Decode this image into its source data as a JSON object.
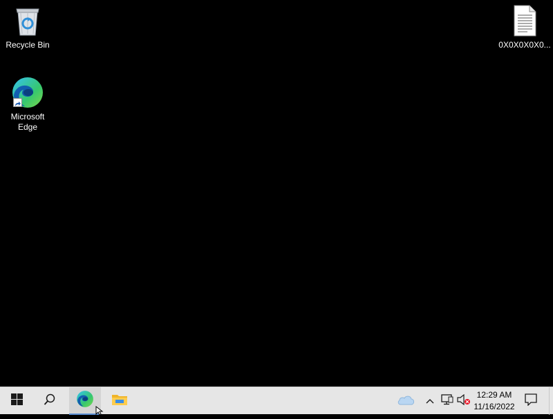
{
  "desktop": {
    "icons": [
      {
        "label": "Recycle Bin",
        "icon": "recycle-bin-icon"
      },
      {
        "label": "Microsoft Edge",
        "icon": "edge-icon"
      },
      {
        "label": "0X0X0X0X0...",
        "icon": "text-file-icon"
      }
    ]
  },
  "taskbar": {
    "start_icon": "windows-logo-icon",
    "search_icon": "search-icon",
    "pinned": [
      {
        "name": "Microsoft Edge",
        "icon": "edge-icon",
        "active": true
      },
      {
        "name": "File Explorer",
        "icon": "folder-icon",
        "active": false
      }
    ],
    "tray": {
      "weather_icon": "cloud-icon",
      "chevron_icon": "chevron-up-icon",
      "network_icon": "network-icon",
      "volume_icon": "volume-muted-icon"
    },
    "clock": {
      "time": "12:29 AM",
      "date": "11/16/2022"
    },
    "notification_icon": "notification-icon"
  },
  "colors": {
    "desktop_bg": "#000000",
    "taskbar_bg": "#e6e6e6",
    "accent": "#5a8fd6"
  }
}
